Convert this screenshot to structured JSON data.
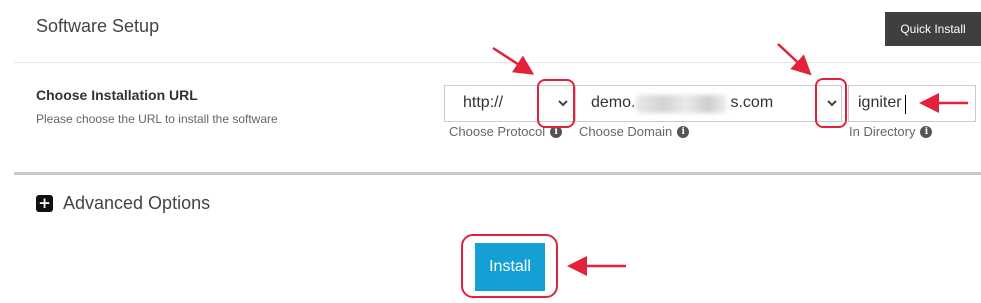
{
  "header": {
    "title": "Software Setup",
    "quick_install_label": "Quick Install"
  },
  "url_section": {
    "label": "Choose Installation URL",
    "description": "Please choose the URL to install the software",
    "protocol": {
      "value": "http://",
      "caption": "Choose Protocol"
    },
    "domain": {
      "prefix": "demo.",
      "suffix": "s.com",
      "caption": "Choose Domain"
    },
    "directory": {
      "value": "igniter",
      "caption": "In Directory"
    }
  },
  "advanced": {
    "label": "Advanced Options"
  },
  "install": {
    "label": "Install"
  },
  "icons": {
    "dropdown": "chevron-down-icon",
    "info": "info-circle-icon",
    "expand": "plus-square-icon"
  },
  "colors": {
    "install_button": "#14a0d4",
    "quick_install_button": "#3f3f3f",
    "annotation": "#e3213b"
  }
}
